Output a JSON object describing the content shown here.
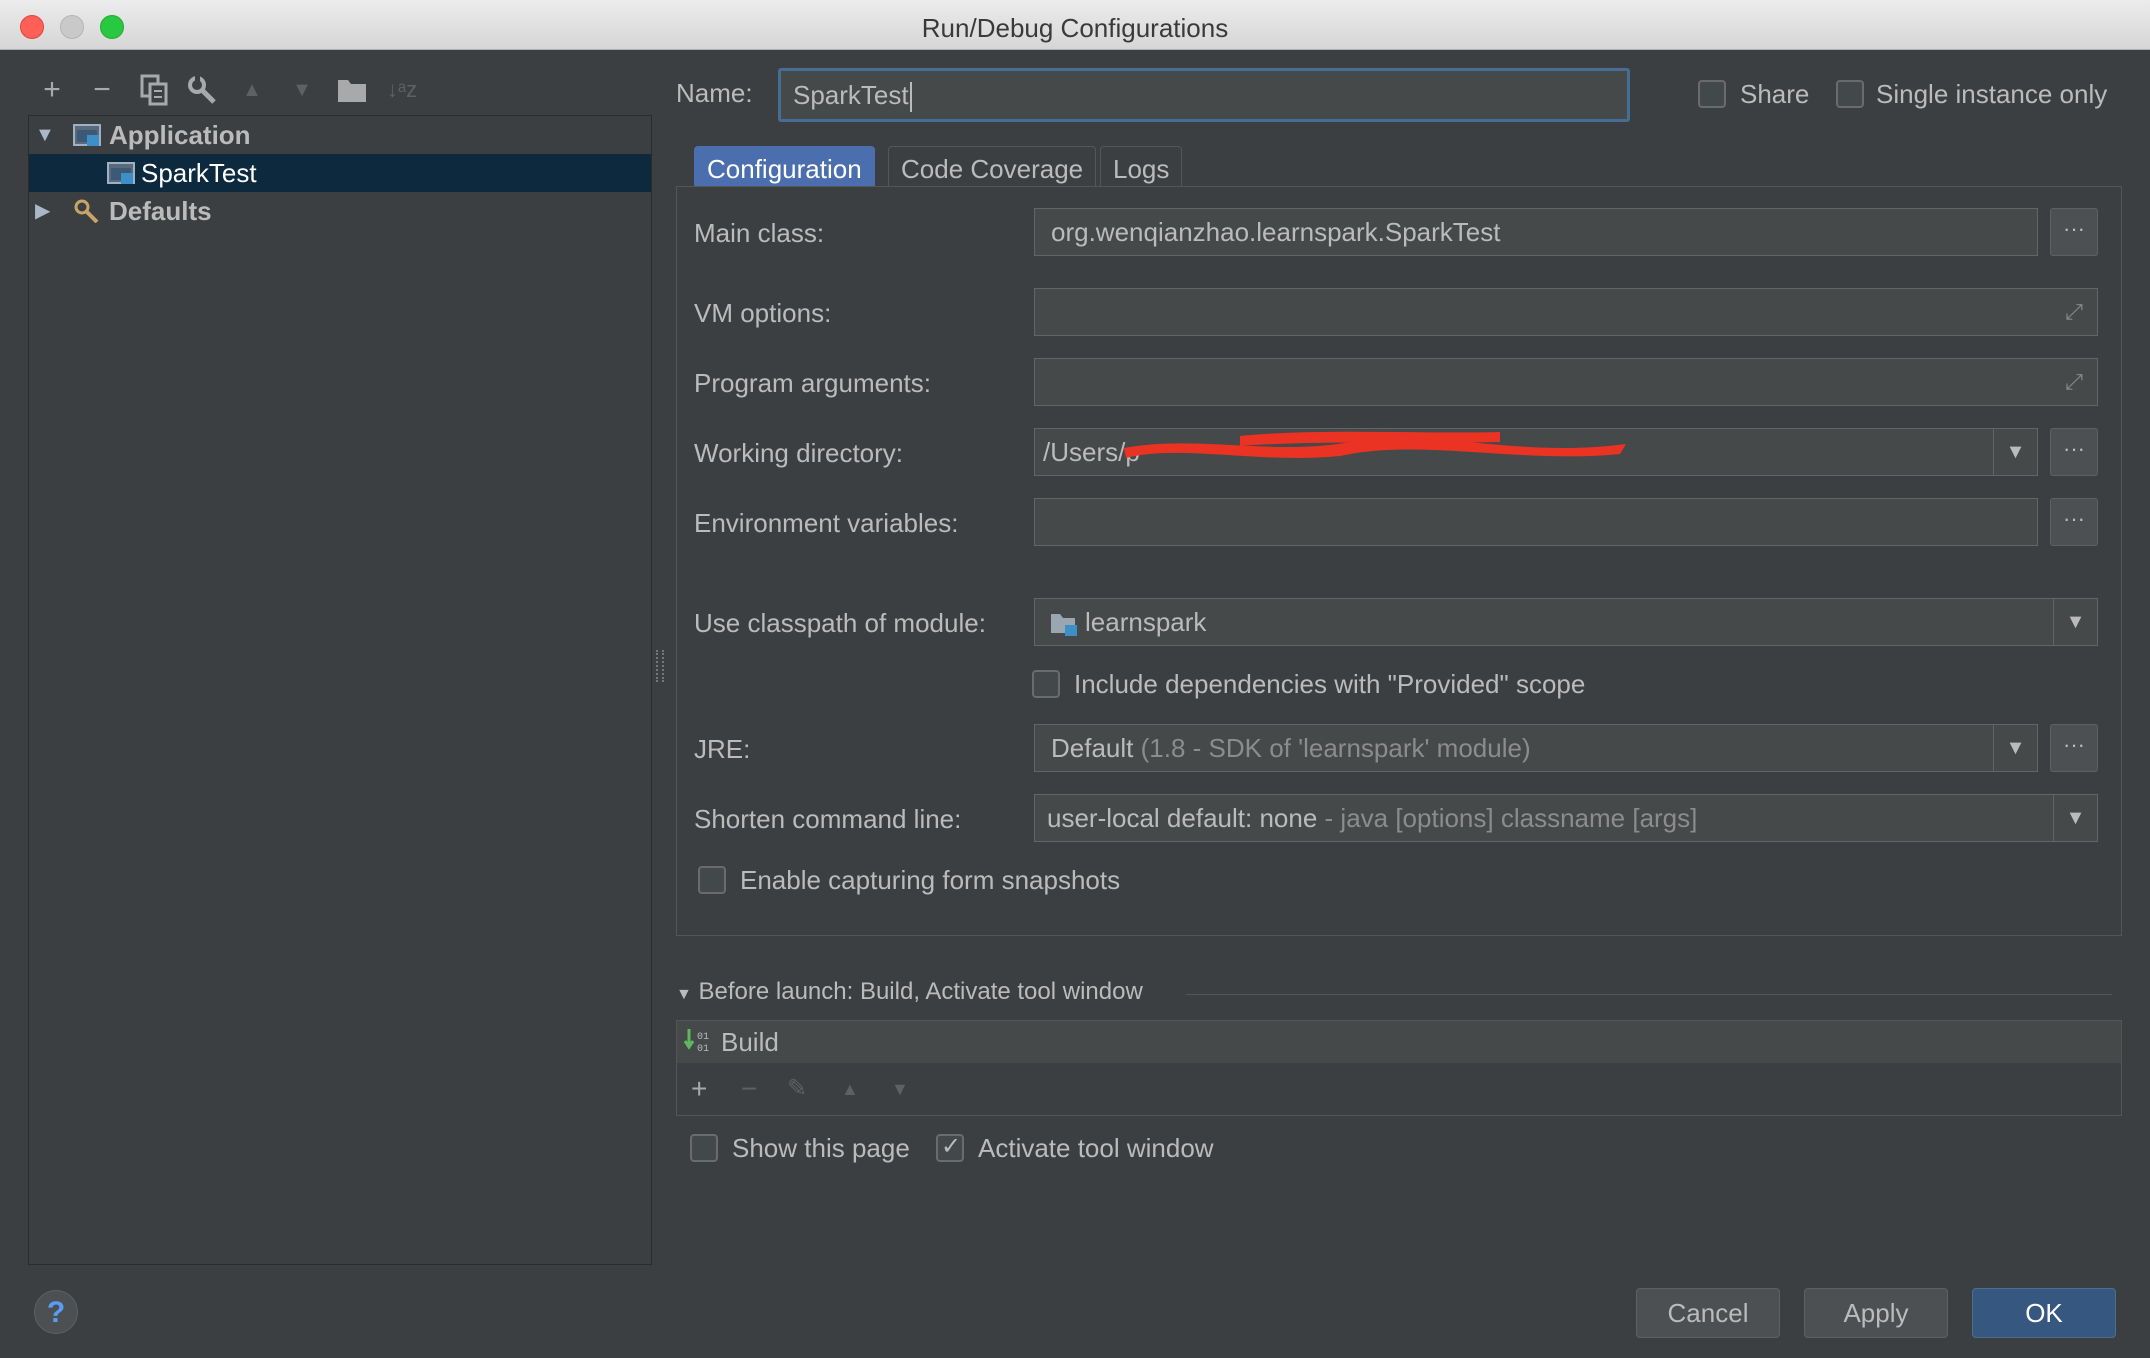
{
  "window": {
    "title": "Run/Debug Configurations"
  },
  "toolbar": {
    "add": "+",
    "remove": "−",
    "copy": "copy-icon",
    "edit": "wrench-icon",
    "up": "▲",
    "down": "▼",
    "folder": "folder-icon",
    "sort": "↓ᵃz"
  },
  "tree": {
    "items": [
      {
        "label": "Application",
        "expanded": true
      },
      {
        "label": "SparkTest",
        "selected": true
      },
      {
        "label": "Defaults",
        "expanded": false
      }
    ]
  },
  "name_field": {
    "label": "Name:",
    "value": "SparkTest"
  },
  "options": {
    "share": "Share",
    "single_instance": "Single instance only"
  },
  "tabs": [
    {
      "label": "Configuration",
      "active": true
    },
    {
      "label": "Code Coverage"
    },
    {
      "label": "Logs"
    }
  ],
  "form": {
    "main_class": {
      "label": "Main class:",
      "value": "org.wenqianzhao.learnspark.SparkTest"
    },
    "vm_options": {
      "label": "VM options:",
      "value": ""
    },
    "program_arguments": {
      "label": "Program arguments:",
      "value": ""
    },
    "working_directory": {
      "label": "Working directory:",
      "value": "/Users/p"
    },
    "environment_variables": {
      "label": "Environment variables:",
      "value": ""
    },
    "classpath_module": {
      "label": "Use classpath of module:",
      "value": "learnspark"
    },
    "include_provided": {
      "label": "Include dependencies with \"Provided\" scope",
      "checked": false
    },
    "jre": {
      "label": "JRE:",
      "value": "Default",
      "detail": "(1.8 - SDK of 'learnspark' module)"
    },
    "shorten_command_line": {
      "label": "Shorten command line:",
      "value": "user-local default: none",
      "detail": "- java [options] classname [args]"
    },
    "enable_snapshots": {
      "label": "Enable capturing form snapshots",
      "checked": false
    }
  },
  "before_launch": {
    "header": "Before launch: Build, Activate tool window",
    "items": [
      {
        "label": "Build"
      }
    ],
    "show_page": {
      "label": "Show this page",
      "checked": false
    },
    "activate_tool_window": {
      "label": "Activate tool window",
      "checked": true
    }
  },
  "buttons": {
    "help": "?",
    "cancel": "Cancel",
    "apply": "Apply",
    "ok": "OK"
  },
  "colors": {
    "accent": "#4b6eaf",
    "selection": "#0d293e",
    "primary_button": "#365880",
    "background": "#3c3f41"
  }
}
